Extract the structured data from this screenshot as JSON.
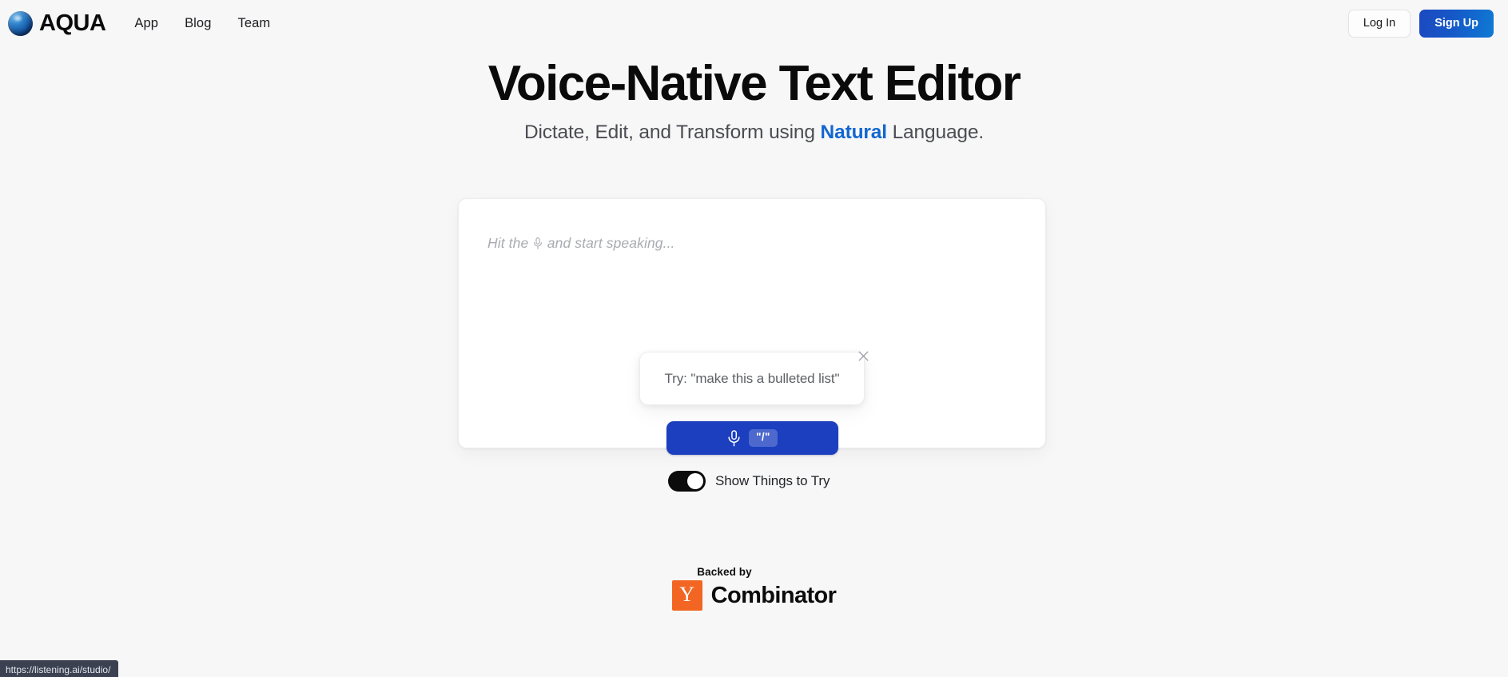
{
  "header": {
    "brand_name": "AQUA",
    "logo_icon": "aqua-orb-icon",
    "nav": [
      {
        "label": "App"
      },
      {
        "label": "Blog"
      },
      {
        "label": "Team"
      }
    ],
    "login_label": "Log In",
    "signup_label": "Sign Up"
  },
  "hero": {
    "headline": "Voice-Native Text Editor",
    "subhead_before": "Dictate, Edit, and Transform using ",
    "subhead_accent": "Natural",
    "subhead_after": " Language."
  },
  "editor": {
    "placeholder_before": "Hit the ",
    "placeholder_mic": "⭕",
    "placeholder_after": " and start speaking..."
  },
  "tooltip": {
    "text": "Try: \"make this a bulleted list\"",
    "close_icon": "close-icon"
  },
  "mic_button": {
    "icon": "microphone-icon",
    "shortcut_badge": "\"/\""
  },
  "toggle": {
    "label": "Show Things to Try",
    "state": "on"
  },
  "yc_badge": {
    "backed_by": "Backed by",
    "y_letter": "Y",
    "combinator": "Combinator"
  },
  "status_bar": {
    "text": "https://listening.ai/studio/"
  },
  "colors": {
    "page_bg": "#f7f7f8",
    "accent_blue": "#1266cf",
    "signup_gradient_start": "#1c49bf",
    "signup_gradient_end": "#0f7ad4",
    "mic_button_blue": "#1b3fbf",
    "toggle_on": "#0b0b0c",
    "yc_orange": "#f26522"
  }
}
